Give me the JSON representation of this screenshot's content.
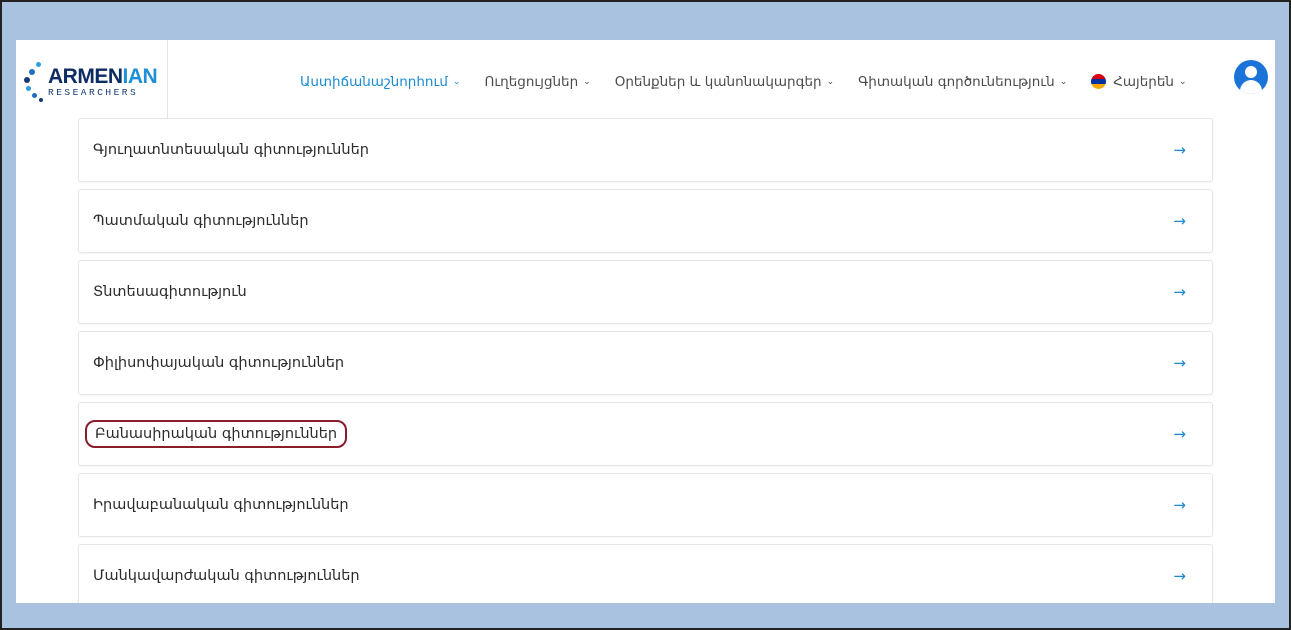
{
  "logo": {
    "text_main_a": "ARMEN",
    "text_main_b": "IAN",
    "text_sub": "RESEARCHERS"
  },
  "nav": [
    {
      "label": "Աստիճանաշնորհում",
      "caret": "⌄",
      "active": true
    },
    {
      "label": "Ուղեցույցներ",
      "caret": "⌄",
      "active": false
    },
    {
      "label": "Օրենքներ և կանոնակարգեր",
      "caret": "⌄",
      "active": false
    },
    {
      "label": "Գիտական գործունեություն",
      "caret": "⌄",
      "active": false
    }
  ],
  "language": {
    "label": "Հայերեն",
    "caret": "⌄",
    "flag_colors": [
      "#d90012",
      "#0033a0",
      "#f2a800"
    ]
  },
  "list": {
    "items": [
      {
        "label": "Գյուղատնտեսական գիտություններ"
      },
      {
        "label": "Պատմական գիտություններ"
      },
      {
        "label": "Տնտեսագիտություն"
      },
      {
        "label": "Փիլիսոփայական գիտություններ"
      },
      {
        "label": "Բանասիրական գիտություններ"
      },
      {
        "label": "Իրավաբանական գիտություններ"
      },
      {
        "label": "Մանկավարժական գիտություններ"
      }
    ],
    "arrow": "→",
    "highlighted_index": 4
  },
  "colors": {
    "accent": "#1a8bd0",
    "highlight": "#8a1c2b",
    "background": "#a9c2df",
    "avatar": "#1a73d9"
  }
}
